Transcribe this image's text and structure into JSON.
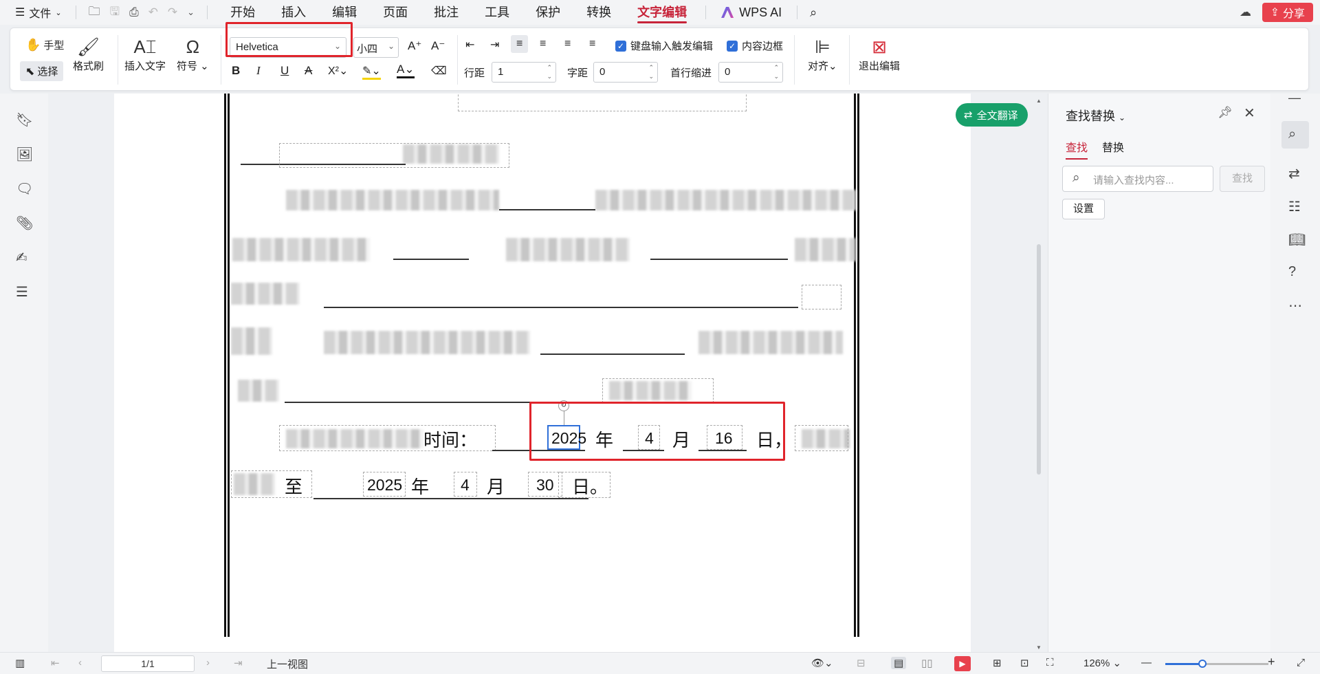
{
  "menubar": {
    "file_label": "文件",
    "tabs": [
      {
        "label": "开始"
      },
      {
        "label": "插入"
      },
      {
        "label": "编辑"
      },
      {
        "label": "页面"
      },
      {
        "label": "批注"
      },
      {
        "label": "工具"
      },
      {
        "label": "保护"
      },
      {
        "label": "转换"
      },
      {
        "label": "文字编辑"
      }
    ],
    "active_tab": "文字编辑",
    "wps_ai_label": "WPS AI",
    "share_label": "分享",
    "accent_color": "#c7243a",
    "share_color": "#e8414d"
  },
  "ribbon": {
    "hand_label": "手型",
    "select_label": "选择",
    "format_painter_label": "格式刷",
    "insert_text_label": "插入文字",
    "symbol_label": "符号",
    "font_name": "Helvetica",
    "font_size": "小四",
    "keyboard_trigger_label": "键盘输入触发编辑",
    "content_border_label": "内容边框",
    "line_spacing_label": "行距",
    "line_spacing_value": "1",
    "char_spacing_label": "字距",
    "char_spacing_value": "0",
    "indent_label": "首行缩进",
    "indent_value": "0",
    "align_label": "对齐",
    "exit_edit_label": "退出编辑"
  },
  "document": {
    "time_label": "时间：",
    "start_year": "2025",
    "year_char": "年",
    "start_month": "4",
    "month_char": "月",
    "start_day": "16",
    "day_char": "日，",
    "to_char": "至",
    "end_year": "2025",
    "end_month": "4",
    "end_day": "30",
    "end_day_char": "日。",
    "translate_label": "全文翻译"
  },
  "find_panel": {
    "title": "查找替换",
    "tab_find": "查找",
    "tab_replace": "替换",
    "search_placeholder": "请输入查找内容...",
    "find_button": "查找",
    "settings_button": "设置"
  },
  "statusbar": {
    "page_indicator": "1/1",
    "prev_view_label": "上一视图",
    "zoom_level": "126%",
    "zoom_fraction": 0.36
  }
}
